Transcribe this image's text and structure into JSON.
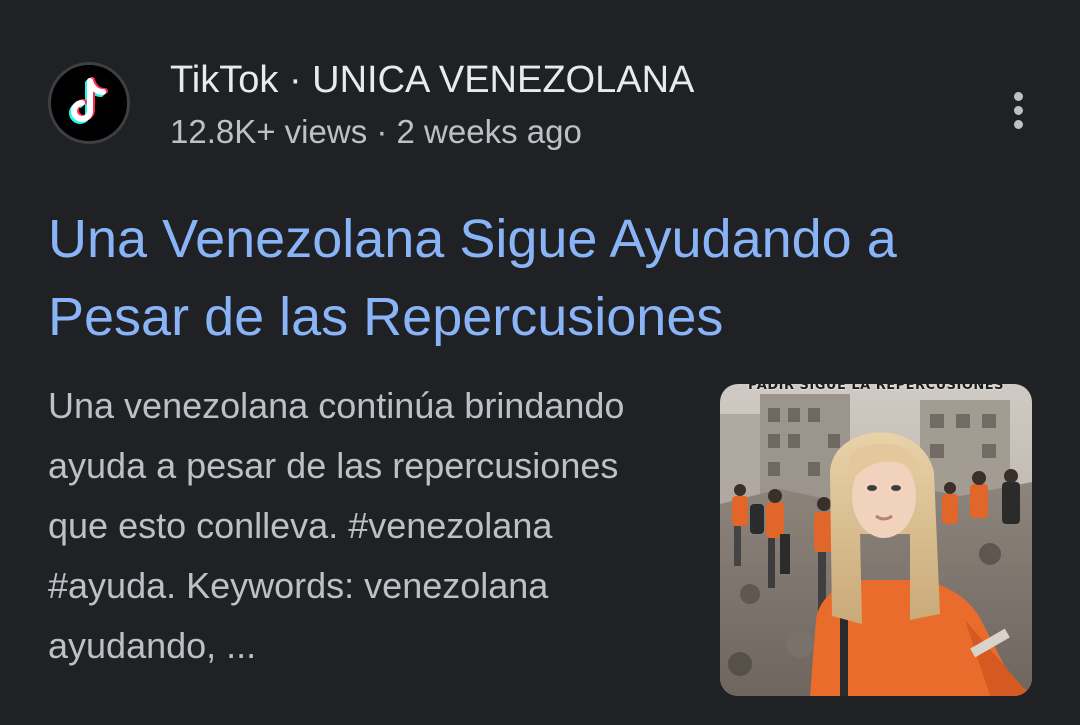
{
  "result": {
    "source": {
      "site_name": "TikTok",
      "separator": " · ",
      "channel": "UNICA VENEZOLANA",
      "favicon_icon": "tiktok-logo-icon"
    },
    "meta": {
      "views": "12.8K+ views",
      "separator": " · ",
      "age": "2 weeks ago"
    },
    "more_icon": "more-vert-icon",
    "title": "Una Venezolana Sigue Ayudando a Pesar de las Repercusiones",
    "snippet": "Una venezolana continúa brindando ayuda a pesar de las repercusiones que esto conlleva. #venezolana #ayuda. Keywords: venezolana ayudando, ...",
    "thumbnail": {
      "caption": "PADIR SIGUE LA REPERCUSIONES"
    }
  },
  "colors": {
    "background": "#202124",
    "title_link": "#8ab4f8",
    "primary_text": "#e8eaed",
    "secondary_text": "#bdc1c6",
    "tiktok_cyan": "#25f4ee",
    "tiktok_red": "#fe2c55"
  }
}
